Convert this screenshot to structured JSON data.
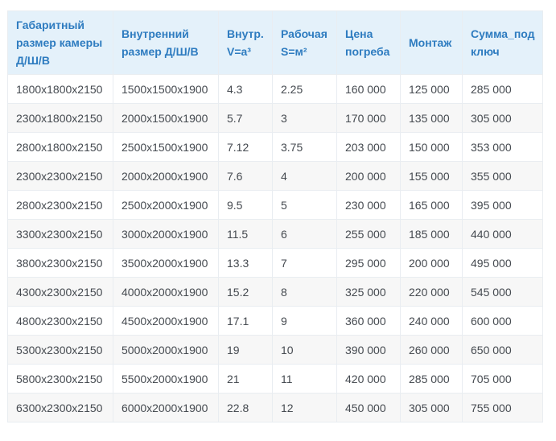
{
  "table": {
    "headers": [
      "Габаритный размер камеры Д/Ш/В",
      "Внутренний размер Д/Ш/В",
      "Внутр. V=а³",
      "Рабочая S=м²",
      "Цена погреба",
      "Монтаж",
      "Сумма_под ключ"
    ],
    "rows": [
      [
        "1800x1800x2150",
        "1500x1500x1900",
        "4.3",
        "2.25",
        "160 000",
        "125 000",
        "285 000"
      ],
      [
        "2300x1800x2150",
        "2000x1500x1900",
        "5.7",
        "3",
        "170 000",
        "135 000",
        "305 000"
      ],
      [
        "2800x1800x2150",
        "2500x1500x1900",
        "7.12",
        "3.75",
        "203 000",
        "150 000",
        "353 000"
      ],
      [
        "2300x2300x2150",
        "2000x2000x1900",
        "7.6",
        "4",
        "200 000",
        "155 000",
        "355 000"
      ],
      [
        "2800x2300x2150",
        "2500x2000x1900",
        "9.5",
        "5",
        "230 000",
        "165 000",
        "395 000"
      ],
      [
        "3300x2300x2150",
        "3000x2000x1900",
        "11.5",
        "6",
        "255 000",
        "185 000",
        "440 000"
      ],
      [
        "3800x2300x2150",
        "3500x2000x1900",
        "13.3",
        "7",
        "295 000",
        "200 000",
        "495 000"
      ],
      [
        "4300x2300x2150",
        "4000x2000x1900",
        "15.2",
        "8",
        "325 000",
        "220 000",
        "545 000"
      ],
      [
        "4800x2300x2150",
        "4500x2000x1900",
        "17.1",
        "9",
        "360 000",
        "240 000",
        "600 000"
      ],
      [
        "5300x2300x2150",
        "5000x2000x1900",
        "19",
        "10",
        "390 000",
        "260 000",
        "650 000"
      ],
      [
        "5800x2300x2150",
        "5500x2000x1900",
        "21",
        "11",
        "420 000",
        "285 000",
        "705 000"
      ],
      [
        "6300x2300x2150",
        "6000x2000x1900",
        "22.8",
        "12",
        "450 000",
        "305 000",
        "755 000"
      ]
    ]
  },
  "colors": {
    "header_bg": "#e4f1fa",
    "header_text": "#2e7cc0",
    "row_alt_bg": "#f7f7f7",
    "cell_text": "#454a50",
    "border": "#e9edf1"
  }
}
